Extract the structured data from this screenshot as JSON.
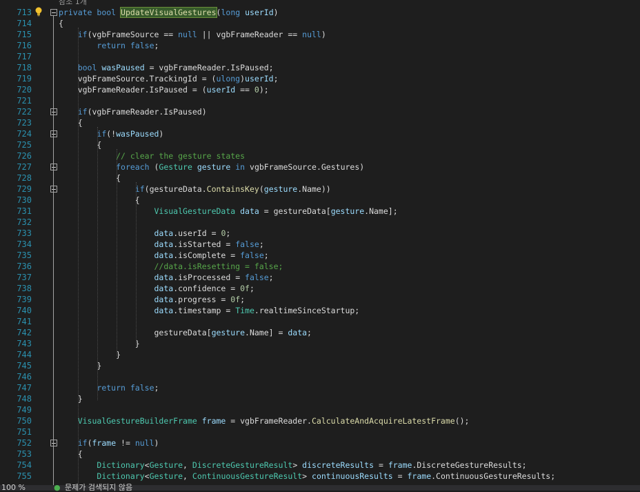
{
  "codelens": "참조 1개",
  "lines": [
    {
      "num": "713",
      "html": "<span class=\"k\">private</span> <span class=\"k\">bool</span> <span class=\"m hl\">UpdateVisualGestures</span>(<span class=\"k\">long</span> <span class=\"p\">userId</span>)"
    },
    {
      "num": "714",
      "html": "{"
    },
    {
      "num": "715",
      "html": "    <span class=\"k\">if</span>(vgbFrameSource == <span class=\"k\">null</span> || vgbFrameReader == <span class=\"k\">null</span>)"
    },
    {
      "num": "716",
      "html": "        <span class=\"k\">return</span> <span class=\"k\">false</span>;"
    },
    {
      "num": "717",
      "html": ""
    },
    {
      "num": "718",
      "html": "    <span class=\"k\">bool</span> <span class=\"v\">wasPaused</span> = vgbFrameReader.IsPaused;"
    },
    {
      "num": "719",
      "html": "    vgbFrameSource.TrackingId = (<span class=\"k\">ulong</span>)<span class=\"p\">userId</span>;"
    },
    {
      "num": "720",
      "html": "    vgbFrameReader.IsPaused = (<span class=\"p\">userId</span> == <span class=\"n\">0</span>);"
    },
    {
      "num": "721",
      "html": ""
    },
    {
      "num": "722",
      "html": "    <span class=\"k\">if</span>(vgbFrameReader.IsPaused)"
    },
    {
      "num": "723",
      "html": "    {"
    },
    {
      "num": "724",
      "html": "        <span class=\"k\">if</span>(!<span class=\"v\">wasPaused</span>)"
    },
    {
      "num": "725",
      "html": "        {"
    },
    {
      "num": "726",
      "html": "            <span class=\"c\">// clear the gesture states</span>"
    },
    {
      "num": "727",
      "html": "            <span class=\"k\">foreach</span> (<span class=\"t\">Gesture</span> <span class=\"v\">gesture</span> <span class=\"k\">in</span> vgbFrameSource.Gestures)"
    },
    {
      "num": "728",
      "html": "            {"
    },
    {
      "num": "729",
      "html": "                <span class=\"k\">if</span>(gestureData.<span class=\"m\">ContainsKey</span>(<span class=\"v\">gesture</span>.Name))"
    },
    {
      "num": "730",
      "html": "                {"
    },
    {
      "num": "731",
      "html": "                    <span class=\"t\">VisualGestureData</span> <span class=\"v\">data</span> = gestureData[<span class=\"v\">gesture</span>.Name];"
    },
    {
      "num": "732",
      "html": ""
    },
    {
      "num": "733",
      "html": "                    <span class=\"v\">data</span>.userId = <span class=\"n\">0</span>;"
    },
    {
      "num": "734",
      "html": "                    <span class=\"v\">data</span>.isStarted = <span class=\"k\">false</span>;"
    },
    {
      "num": "735",
      "html": "                    <span class=\"v\">data</span>.isComplete = <span class=\"k\">false</span>;"
    },
    {
      "num": "736",
      "html": "                    <span class=\"c\">//data.isResetting = false;</span>"
    },
    {
      "num": "737",
      "html": "                    <span class=\"v\">data</span>.isProcessed = <span class=\"k\">false</span>;"
    },
    {
      "num": "738",
      "html": "                    <span class=\"v\">data</span>.confidence = <span class=\"n\">0f</span>;"
    },
    {
      "num": "739",
      "html": "                    <span class=\"v\">data</span>.progress = <span class=\"n\">0f</span>;"
    },
    {
      "num": "740",
      "html": "                    <span class=\"v\">data</span>.timestamp = <span class=\"t\">Time</span>.realtimeSinceStartup;"
    },
    {
      "num": "741",
      "html": ""
    },
    {
      "num": "742",
      "html": "                    gestureData[<span class=\"v\">gesture</span>.Name] = <span class=\"v\">data</span>;"
    },
    {
      "num": "743",
      "html": "                }"
    },
    {
      "num": "744",
      "html": "            }"
    },
    {
      "num": "745",
      "html": "        }"
    },
    {
      "num": "746",
      "html": ""
    },
    {
      "num": "747",
      "html": "        <span class=\"k\">return</span> <span class=\"k\">false</span>;"
    },
    {
      "num": "748",
      "html": "    }"
    },
    {
      "num": "749",
      "html": ""
    },
    {
      "num": "750",
      "html": "    <span class=\"t\">VisualGestureBuilderFrame</span> <span class=\"v\">frame</span> = vgbFrameReader.<span class=\"m\">CalculateAndAcquireLatestFrame</span>();"
    },
    {
      "num": "751",
      "html": ""
    },
    {
      "num": "752",
      "html": "    <span class=\"k\">if</span>(<span class=\"v\">frame</span> != <span class=\"k\">null</span>)"
    },
    {
      "num": "753",
      "html": "    {"
    },
    {
      "num": "754",
      "html": "        <span class=\"t\">Dictionary</span>&lt;<span class=\"t\">Gesture</span>, <span class=\"t\">DiscreteGestureResult</span>&gt; <span class=\"v\">discreteResults</span> = <span class=\"v\">frame</span>.DiscreteGestureResults;"
    },
    {
      "num": "755",
      "html": "        <span class=\"t\">Dictionary</span>&lt;<span class=\"t\">Gesture</span>, <span class=\"t\">ContinuousGestureResult</span>&gt; <span class=\"v\">continuousResults</span> = <span class=\"v\">frame</span>.ContinuousGestureResults;"
    }
  ],
  "status": {
    "zoom": "100 %",
    "issues": "문제가 검색되지 않음"
  }
}
